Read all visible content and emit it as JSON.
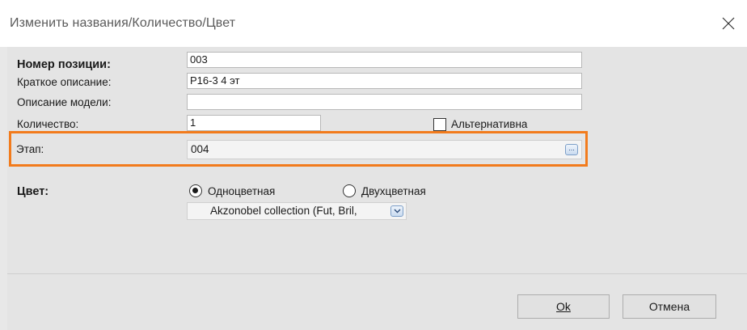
{
  "window": {
    "title": "Изменить названия/Количество/Цвет"
  },
  "form": {
    "position_number_label": "Номер позиции:",
    "position_number_value": "003",
    "short_description_label": "Краткое описание:",
    "short_description_value": "P16-3 4 эт",
    "model_description_label": "Описание модели:",
    "model_description_value": "",
    "quantity_label": "Количество:",
    "quantity_value": "1",
    "alternative_label": "Альтернативна",
    "alternative_checked": false,
    "stage_label": "Этап:",
    "stage_value": "004",
    "stage_button_label": "...",
    "color_label": "Цвет:",
    "radio_single_label": "Одноцветная",
    "radio_double_label": "Двухцветная",
    "selected_color_mode": "Одноцветная",
    "color_collection_value": "Akzonobel collection (Fut, Bril,"
  },
  "buttons": {
    "ok_label": "Ok",
    "cancel_label": "Отмена"
  },
  "colors": {
    "highlight": "#f27b1c",
    "background": "#e4e4e4"
  }
}
